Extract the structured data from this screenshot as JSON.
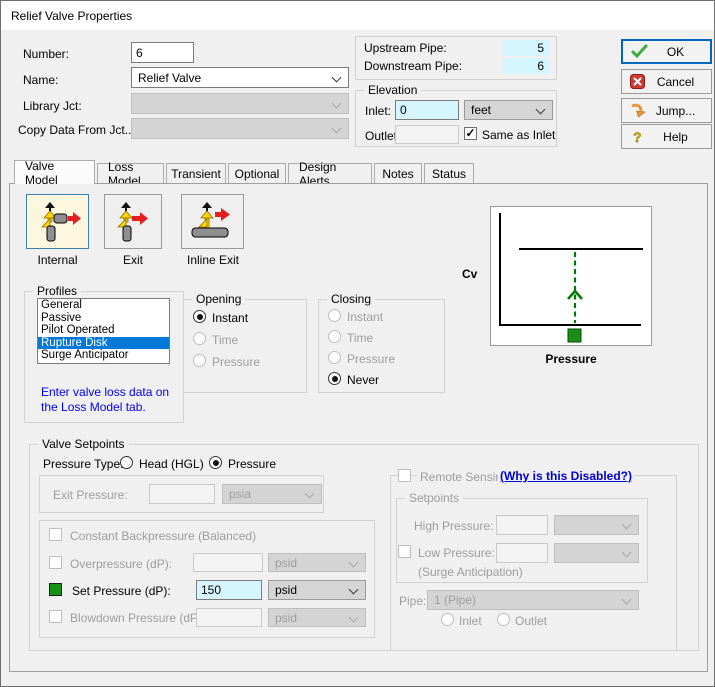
{
  "window": {
    "title": "Relief Valve Properties"
  },
  "colors": {
    "highlight": "#0078D7",
    "field_cyan": "#D6F6FF",
    "note_blue": "#0000FF",
    "link_blue": "#0000D4",
    "set_green": "#119411"
  },
  "form": {
    "number_label": "Number:",
    "number_value": "6",
    "name_label": "Name:",
    "name_value": "Relief Valve",
    "library_label": "Library Jct:",
    "library_value": "",
    "copy_label": "Copy Data From Jct...",
    "copy_value": ""
  },
  "pipes": {
    "upstream_label": "Upstream Pipe:",
    "upstream_value": "5",
    "downstream_label": "Downstream Pipe:",
    "downstream_value": "6"
  },
  "elevation": {
    "title": "Elevation",
    "inlet_label": "Inlet:",
    "inlet_value": "0",
    "unit": "feet",
    "outlet_label": "Outlet:",
    "outlet_value": "",
    "same_as_inlet_label": "Same as Inlet"
  },
  "actions": {
    "ok": "OK",
    "cancel": "Cancel",
    "jump": "Jump...",
    "help": "Help"
  },
  "tabs": [
    "Valve Model",
    "Loss Model",
    "Transient",
    "Optional",
    "Design Alerts",
    "Notes",
    "Status"
  ],
  "active_tab": "Valve Model",
  "valve_model": {
    "types": {
      "internal": "Internal",
      "exit": "Exit",
      "inline_exit": "Inline Exit",
      "selected": "Internal"
    },
    "profiles": {
      "title": "Profiles",
      "items": [
        "General",
        "Passive",
        "Pilot Operated",
        "Rupture Disk",
        "Surge Anticipator"
      ],
      "selected": "Rupture Disk",
      "note_line1": "Enter valve loss data on",
      "note_line2": "the Loss Model tab."
    },
    "opening": {
      "title": "Opening",
      "options": [
        {
          "label": "Instant",
          "selected": true,
          "enabled": true
        },
        {
          "label": "Time",
          "selected": false,
          "enabled": false
        },
        {
          "label": "Pressure",
          "selected": false,
          "enabled": false
        }
      ]
    },
    "closing": {
      "title": "Closing",
      "options": [
        {
          "label": "Instant",
          "selected": false,
          "enabled": false
        },
        {
          "label": "Time",
          "selected": false,
          "enabled": false
        },
        {
          "label": "Pressure",
          "selected": false,
          "enabled": false
        },
        {
          "label": "Never",
          "selected": true,
          "enabled": true
        }
      ]
    },
    "chart": {
      "ylabel": "Cv",
      "xlabel": "Pressure"
    }
  },
  "valve_setpoints": {
    "title": "Valve Setpoints",
    "pressure_type_label": "Pressure Type:",
    "pressure_type_options": [
      {
        "label": "Head (HGL)",
        "selected": false
      },
      {
        "label": "Pressure",
        "selected": true
      }
    ],
    "exit_pressure": {
      "label": "Exit Pressure:",
      "value": "",
      "unit": "psia",
      "enabled": false
    },
    "constant_backpressure_label": "Constant Backpressure (Balanced)",
    "overpressure": {
      "label": "Overpressure (dP):",
      "value": "",
      "unit": "psid",
      "enabled": false
    },
    "set_pressure": {
      "label": "Set Pressure (dP):",
      "value": "150",
      "unit": "psid",
      "enabled": true
    },
    "blowdown": {
      "label": "Blowdown Pressure (dP):",
      "value": "",
      "unit": "psid",
      "enabled": false
    },
    "remote_sensing": {
      "label": "Remote Sensing",
      "link": "(Why is this Disabled?)",
      "enabled": false
    },
    "setpoints_group": {
      "title": "Setpoints",
      "high_label": "High Pressure:",
      "high_value": "",
      "high_unit": "",
      "low_label": "Low Pressure:",
      "low_value": "",
      "low_unit": "",
      "surge_label": "(Surge Anticipation)"
    },
    "pipe": {
      "label": "Pipe:",
      "value": "1 (Pipe)",
      "inlet_label": "Inlet",
      "outlet_label": "Outlet"
    }
  }
}
